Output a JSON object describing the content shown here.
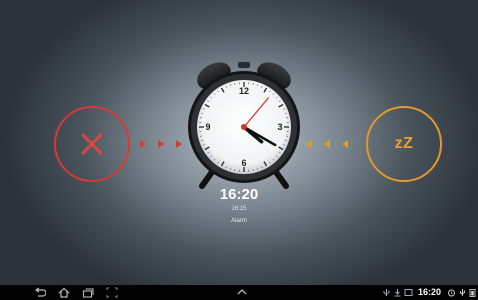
{
  "alarm": {
    "time": "16:20",
    "subtime": "16:15",
    "label": "Alarm",
    "dismiss_symbol": "X",
    "snooze_label": "zZ",
    "dismiss_icon": "close-icon",
    "snooze_icon": "snooze-icon",
    "dismiss_color": "#d63b33",
    "snooze_color": "#e3982c"
  },
  "clock_face": {
    "numbers": [
      "12",
      "3",
      "6",
      "9"
    ],
    "hour": 16,
    "minute": 20,
    "second_hand_color": "#d2322c"
  },
  "navbar": {
    "icons": [
      "back-icon",
      "home-icon",
      "recent-apps-icon",
      "screenshot-icon",
      "menu-up-icon"
    ],
    "status_time": "16:20",
    "status_icons": [
      "usb-icon",
      "download-icon",
      "screenshot-notification-icon",
      "alarm-status-icon",
      "battery-icon"
    ]
  }
}
